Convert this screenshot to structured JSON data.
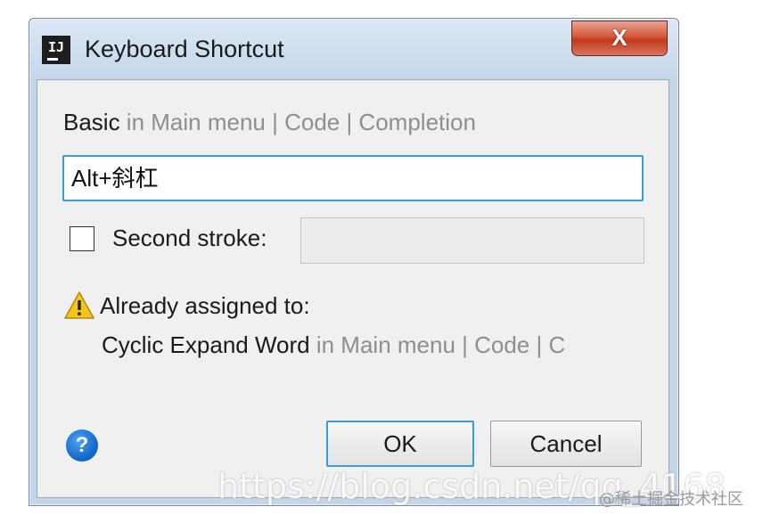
{
  "window": {
    "title": "Keyboard Shortcut",
    "app_icon_text": "IJ",
    "close_glyph": "X"
  },
  "breadcrumb": {
    "action": "Basic",
    "path": " in Main menu | Code | Completion"
  },
  "shortcut_input": {
    "value": "Alt+斜杠"
  },
  "second_stroke": {
    "label": "Second stroke:",
    "checked": false,
    "value": ""
  },
  "warning": {
    "icon": "warning-icon",
    "text": "Already assigned to:",
    "assigned_action": "Cyclic Expand Word",
    "assigned_path": " in Main menu | Code | C"
  },
  "buttons": {
    "help_glyph": "?",
    "ok_label": "OK",
    "cancel_label": "Cancel"
  },
  "watermark": {
    "url": "https://blog.csdn.net/qq_4168",
    "credit": "@稀土掘金技术社区"
  },
  "colors": {
    "focus_border": "#3a9bd8",
    "close_button": "#c23a1c",
    "path_gray": "#8e8e8e",
    "help_blue": "#0d63c9",
    "warning_yellow": "#f5c518"
  }
}
